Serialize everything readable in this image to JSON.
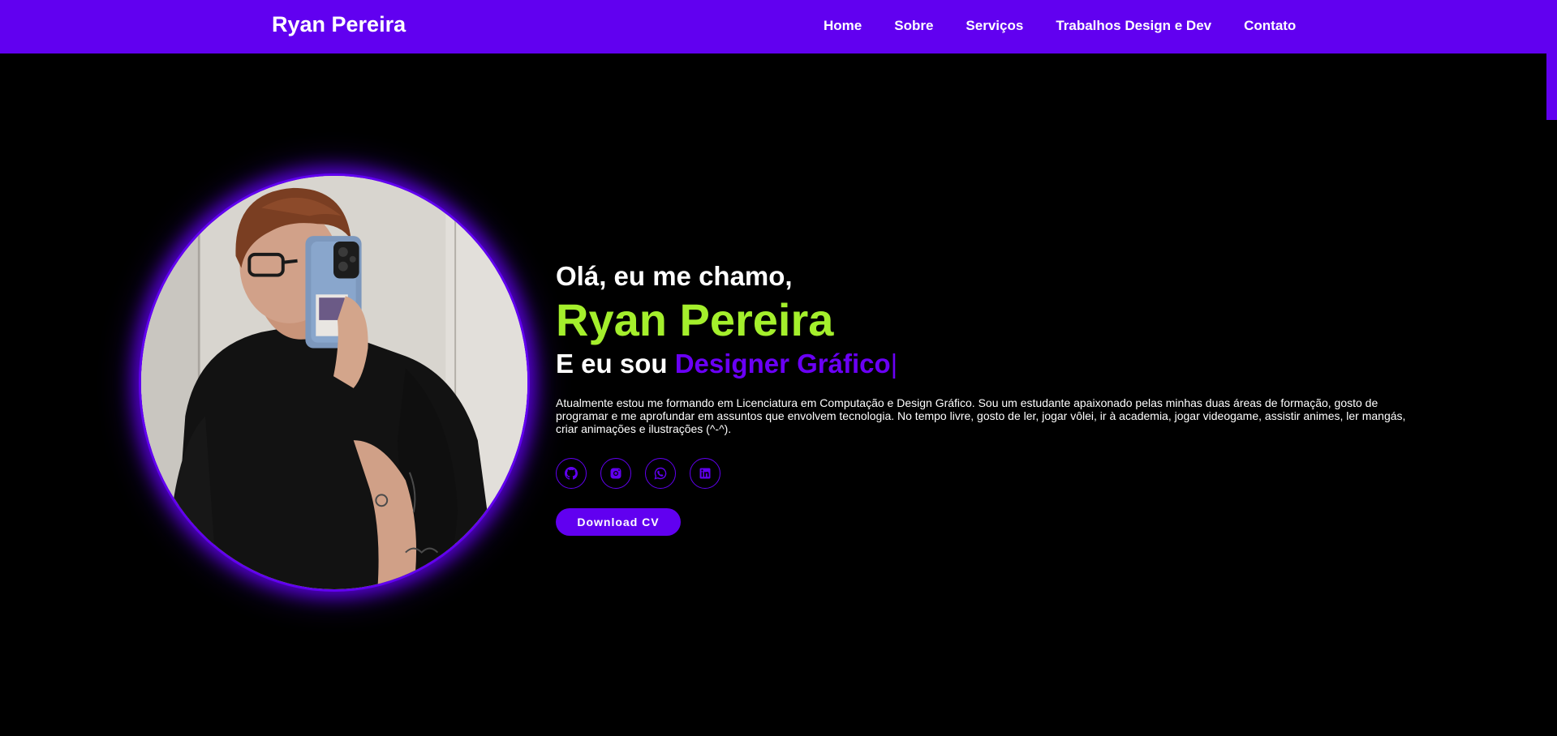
{
  "nav": {
    "brand": "Ryan Pereira",
    "links": [
      "Home",
      "Sobre",
      "Serviços",
      "Trabalhos Design e Dev",
      "Contato"
    ]
  },
  "hero": {
    "greeting": "Olá, eu me chamo,",
    "name": "Ryan Pereira",
    "role_prefix": "E eu sou",
    "role": "Designer Gráfico",
    "cursor": "|",
    "bio": "Atualmente estou me formando em Licenciatura em Computação e Design Gráfico. Sou um estudante apaixonado pelas minhas duas áreas de formação, gosto de programar e me aprofundar em assuntos que envolvem tecnologia. No tempo livre, gosto de ler, jogar vôlei, ir à academia, jogar videogame, assistir animes, ler mangás, criar animações e ilustrações (^-^).",
    "socials": [
      "github-icon",
      "instagram-icon",
      "whatsapp-icon",
      "linkedin-icon"
    ],
    "download_label": "Download CV"
  },
  "colors": {
    "accent": "#6100f0",
    "name": "#a4ef2c",
    "background": "#000000"
  }
}
